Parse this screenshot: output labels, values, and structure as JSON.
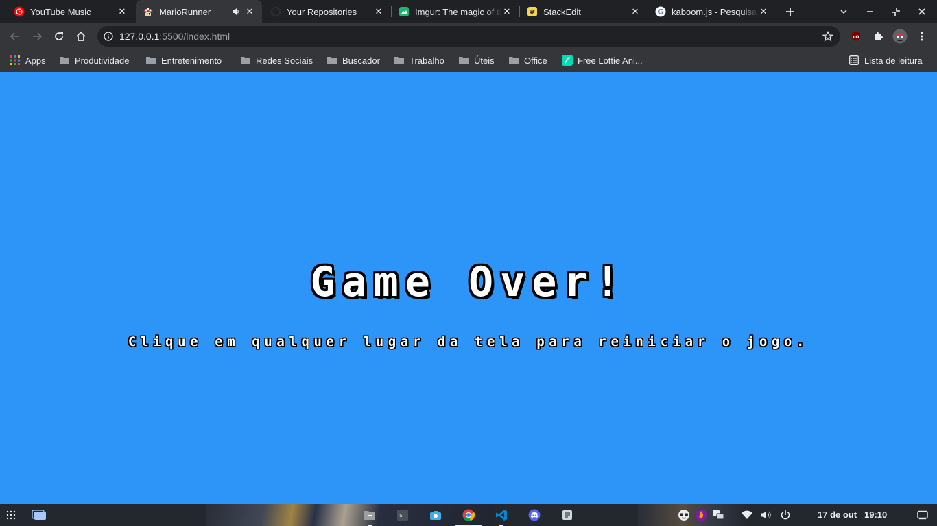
{
  "tabs": [
    {
      "title": "YouTube Music",
      "favicon": "youtube-music-icon"
    },
    {
      "title": "MarioRunner",
      "favicon": "mushroom-icon",
      "active": true,
      "audio": true
    },
    {
      "title": "Your Repositories",
      "favicon": "github-icon"
    },
    {
      "title": "Imgur: The magic of the Internet",
      "favicon": "imgur-icon"
    },
    {
      "title": "StackEdit",
      "favicon": "stackedit-icon"
    },
    {
      "title": "kaboom.js - Pesquisa Google",
      "favicon": "google-icon"
    }
  ],
  "address": {
    "host": "127.0.0.1",
    "rest": ":5500/index.html"
  },
  "bookmarks": {
    "apps": "Apps",
    "items": [
      "Produtividade",
      "Entretenimento",
      "Redes Sociais",
      "Buscador",
      "Trabalho",
      "Úteis",
      "Office"
    ],
    "lottie": "Free Lottie Ani...",
    "reading_list": "Lista de leitura"
  },
  "game": {
    "title": "Game Over!",
    "subtitle": "Clique em qualquer lugar da tela para reiniciar o jogo."
  },
  "taskbar": {
    "date": "17 de out",
    "time": "19:10"
  },
  "colors": {
    "page_background": "#2d95f8",
    "tabstrip": "#202124",
    "toolbar": "#35363a"
  }
}
